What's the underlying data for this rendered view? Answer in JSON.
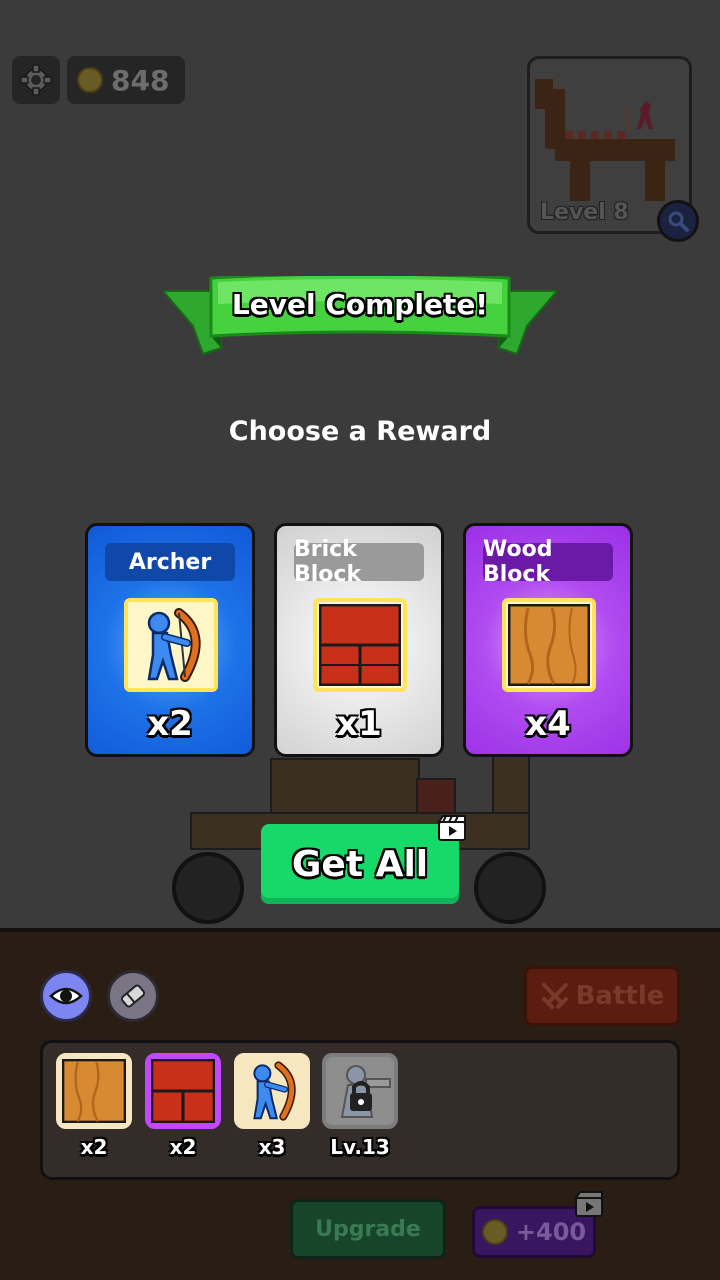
{
  "hud": {
    "coins": "848",
    "preview_level": "Level 8"
  },
  "banner": {
    "title": "Level Complete!"
  },
  "prompt": "Choose a Reward",
  "rewards": [
    {
      "name": "Archer",
      "quantity": "x2",
      "icon": "archer-icon"
    },
    {
      "name": "Brick Block",
      "quantity": "x1",
      "icon": "brick-icon"
    },
    {
      "name": "Wood Block",
      "quantity": "x4",
      "icon": "wood-icon"
    }
  ],
  "get_all": {
    "label": "Get All",
    "icon": "video-ad-icon"
  },
  "controls": {
    "battle_label": "Battle",
    "upgrade_label": "Upgrade",
    "coin_reward": "+400"
  },
  "inventory": [
    {
      "item": "wood-block",
      "count": "x2"
    },
    {
      "item": "brick-block",
      "count": "x2",
      "selected": true
    },
    {
      "item": "archer",
      "count": "x3"
    },
    {
      "item": "locked-unit",
      "count": "Lv.13",
      "locked": true
    }
  ],
  "colors": {
    "archer_card": "#1e73e8",
    "brick_card": "#e9e9e9",
    "wood_card": "#b04cf0",
    "get_all": "#17d96a",
    "banner": "#3cc83c"
  }
}
